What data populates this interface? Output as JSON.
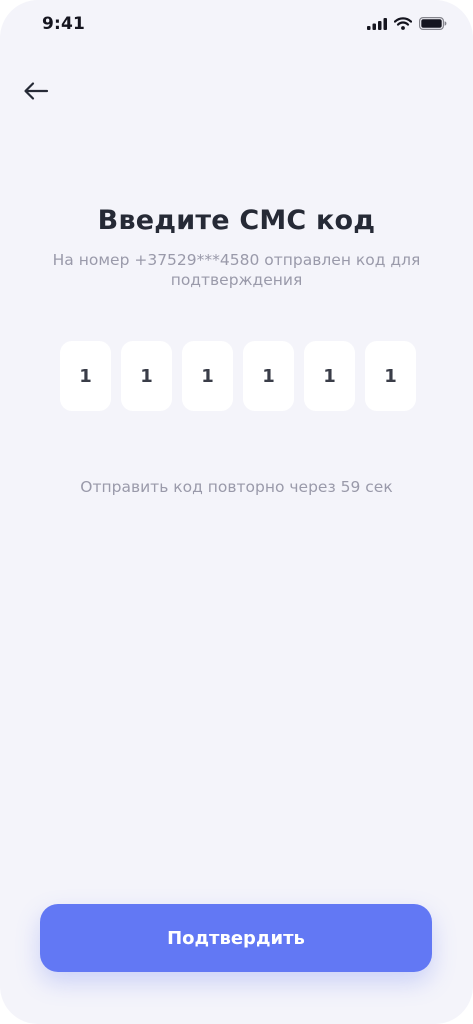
{
  "status_bar": {
    "time": "9:41",
    "icons": [
      "cellular-signal-icon",
      "wifi-icon",
      "battery-icon"
    ]
  },
  "header": {
    "back_icon": "arrow-left-icon"
  },
  "main": {
    "title": "Введите СМС код",
    "subtitle": "На номер +37529***4580 отправлен код для подтверждения",
    "code_digits": [
      "1",
      "1",
      "1",
      "1",
      "1",
      "1"
    ],
    "resend_text": "Отправить код повторно через 59 сек"
  },
  "footer": {
    "confirm_label": "Подтвердить"
  },
  "colors": {
    "background": "#f4f4fa",
    "accent": "#6278f4",
    "title": "#262a36",
    "muted_text": "#9a9aaa",
    "input_bg": "#ffffff"
  }
}
